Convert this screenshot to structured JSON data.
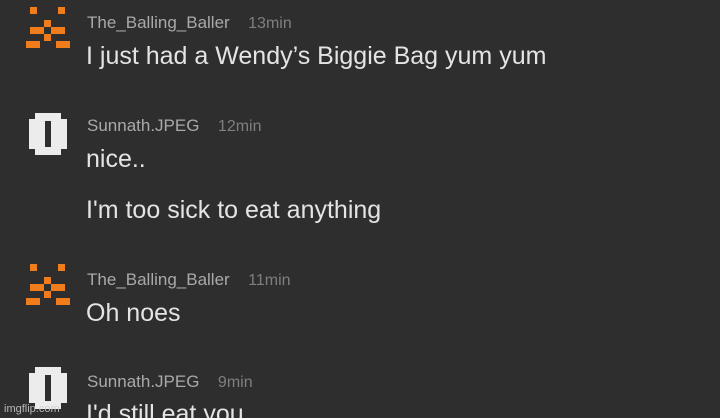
{
  "messages": [
    {
      "author": "The_Balling_Baller",
      "time": "13min",
      "avatar_icon": "orange-pixel-face-icon",
      "lines": [
        "I just had a Wendy’s Biggie Bag yum yum"
      ]
    },
    {
      "author": "Sunnath.JPEG",
      "time": "12min",
      "avatar_icon": "white-pixel-block-icon",
      "lines": [
        "nice..",
        "I'm too sick to eat anything"
      ]
    },
    {
      "author": "The_Balling_Baller",
      "time": "11min",
      "avatar_icon": "orange-pixel-face-icon",
      "lines": [
        "Oh noes"
      ]
    },
    {
      "author": "Sunnath.JPEG",
      "time": "9min",
      "avatar_icon": "white-pixel-block-icon",
      "lines": [
        "I'd still eat you"
      ]
    }
  ],
  "watermark": "imgflip.com",
  "colors": {
    "background": "#2e2e2e",
    "username": "#a9a9a9",
    "timestamp": "#7f7f7f",
    "message_text": "#e4e4e4",
    "avatar_orange": "#f07c1c",
    "avatar_white": "#ececec"
  }
}
